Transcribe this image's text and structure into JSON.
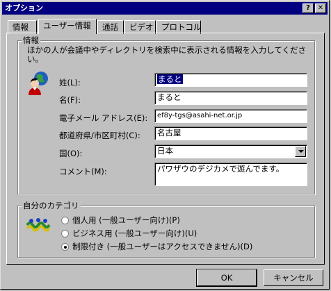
{
  "window": {
    "title": "オプション",
    "help_label": "?",
    "close_label": "✕"
  },
  "tabs": [
    {
      "label": "情報"
    },
    {
      "label": "ユーザー情報",
      "active": true
    },
    {
      "label": "通話"
    },
    {
      "label": "ビデオ"
    },
    {
      "label": "プロトコル"
    }
  ],
  "info_group": {
    "label": "情報",
    "description": "ほかの人が会議中やディレクトリを検索中に表示される情報を入力してください。",
    "icon": "person-globe-icon",
    "fields": [
      {
        "label": "姓(L):",
        "value": "まると"
      },
      {
        "label": "名(F):",
        "value": "まると"
      },
      {
        "label": "電子メール アドレス(E):",
        "value": "ef8y-tgs@asahi-net.or.jp"
      },
      {
        "label": "都道府県/市区町村(C):",
        "value": "名古屋"
      },
      {
        "label": "国(O):",
        "value": "日本"
      },
      {
        "label": "コメント(M):",
        "value": "パワザウのデジカメで遊んでます。"
      }
    ]
  },
  "category_group": {
    "label": "自分のカテゴリ",
    "icon": "people-wave-icon",
    "options": [
      {
        "label": "個人用 (一般ユーザー向け)(P)",
        "selected": false
      },
      {
        "label": "ビジネス用 (一般ユーザー向け)(U)",
        "selected": false
      },
      {
        "label": "制限付き (一般ユーザーはアクセスできません)(D)",
        "selected": true
      }
    ]
  },
  "buttons": {
    "ok": "OK",
    "cancel": "キャンセル"
  }
}
